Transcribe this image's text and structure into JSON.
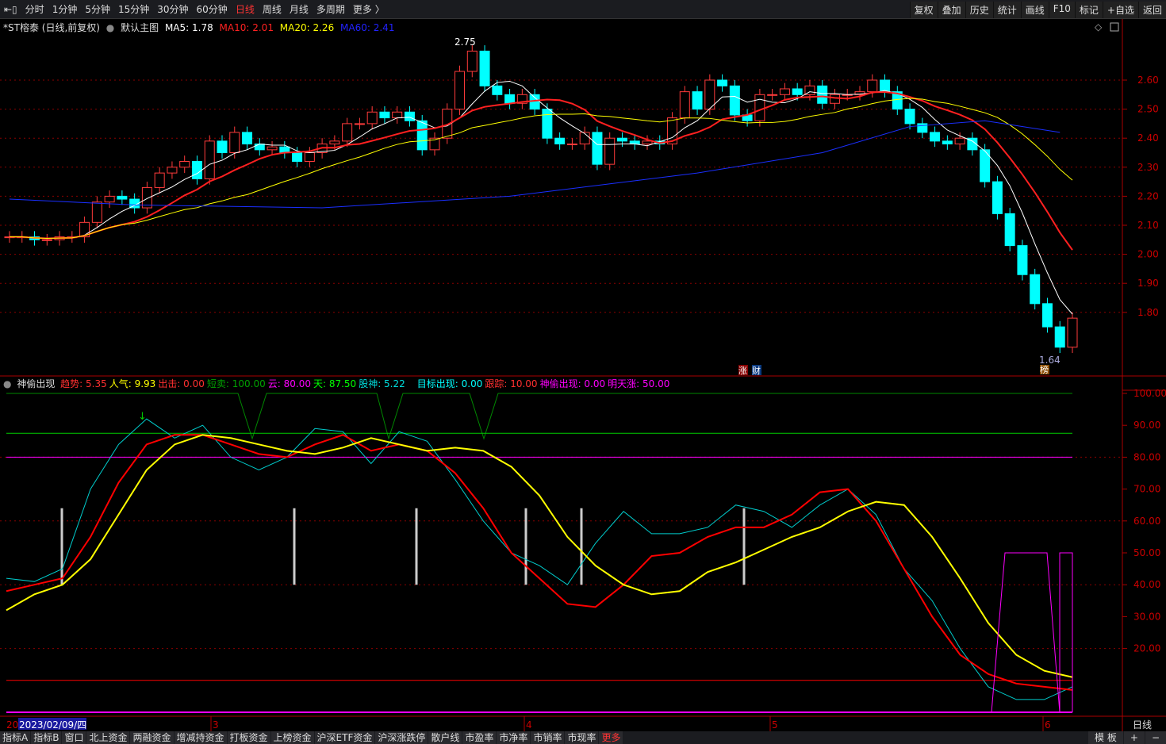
{
  "toolbar": {
    "tabs": [
      "分时",
      "1分钟",
      "5分钟",
      "15分钟",
      "30分钟",
      "60分钟",
      "日线",
      "周线",
      "月线",
      "多周期",
      "更多 〉"
    ],
    "active": "日线",
    "right": [
      "复权",
      "叠加",
      "历史",
      "统计",
      "画线",
      "F10",
      "标记",
      "+自选",
      "返回"
    ]
  },
  "info": {
    "title": "*ST榕泰 (日线,前复权)",
    "main": "默认主图",
    "ma5": "MA5: 1.78",
    "ma10": "MA10: 2.01",
    "ma20": "MA20: 2.26",
    "ma60": "MA60: 2.41"
  },
  "colors": {
    "up": "#ff3b3b",
    "down": "#00ffff",
    "ma5": "#ffffff",
    "ma10": "#ff2020",
    "ma20": "#ffff00",
    "ma60": "#1a2fff",
    "grid": "#8b0000"
  },
  "price_axis": [
    "2.60",
    "2.50",
    "2.40",
    "2.30",
    "2.20",
    "2.10",
    "2.00",
    "1.90",
    "1.80"
  ],
  "annotations": {
    "high": "2.75",
    "low": "1.64",
    "badge_bang": "榜",
    "badge_zhang": "涨",
    "badge_cai": "财"
  },
  "chart_data": {
    "type": "candlestick",
    "closes": [
      2.06,
      2.06,
      2.05,
      2.05,
      2.06,
      2.06,
      2.11,
      2.18,
      2.2,
      2.19,
      2.16,
      2.23,
      2.28,
      2.3,
      2.32,
      2.26,
      2.39,
      2.35,
      2.42,
      2.38,
      2.36,
      2.37,
      2.35,
      2.32,
      2.35,
      2.38,
      2.39,
      2.45,
      2.45,
      2.49,
      2.47,
      2.49,
      2.46,
      2.36,
      2.4,
      2.5,
      2.63,
      2.7,
      2.58,
      2.55,
      2.52,
      2.55,
      2.5,
      2.4,
      2.38,
      2.38,
      2.42,
      2.31,
      2.4,
      2.39,
      2.38,
      2.39,
      2.38,
      2.47,
      2.56,
      2.5,
      2.6,
      2.58,
      2.48,
      2.46,
      2.55,
      2.55,
      2.57,
      2.55,
      2.58,
      2.52,
      2.55,
      2.55,
      2.56,
      2.6,
      2.56,
      2.5,
      2.45,
      2.42,
      2.39,
      2.38,
      2.4,
      2.36,
      2.25,
      2.14,
      2.03,
      1.93,
      1.83,
      1.75,
      1.68,
      1.78
    ],
    "ma60": [
      [
        0,
        2.19
      ],
      [
        10,
        2.17
      ],
      [
        25,
        2.16
      ],
      [
        40,
        2.2
      ],
      [
        55,
        2.28
      ],
      [
        65,
        2.35
      ],
      [
        72,
        2.44
      ],
      [
        78,
        2.46
      ],
      [
        84,
        2.42
      ]
    ],
    "price_range": [
      1.62,
      2.82
    ]
  },
  "indicator": {
    "name": "神偷出现",
    "items": [
      [
        "趋势: 5.35",
        "#ff3030"
      ],
      [
        "人气: 9.93",
        "#ffff00"
      ],
      [
        "出击: 0.00",
        "#ff3030"
      ],
      [
        "短卖: 100.00",
        "#00a000"
      ],
      [
        "云: 80.00",
        "#ff00ff"
      ],
      [
        "天: 87.50",
        "#00ff00"
      ],
      [
        "股神: 5.22",
        "#00dddd"
      ],
      [
        "目标出现: 0.00",
        "#00ffff"
      ],
      [
        "跟踪: 10.00",
        "#ff3030"
      ],
      [
        "神偷出现: 0.00",
        "#ff00ff"
      ],
      [
        "明天涨: 50.00",
        "#ff00ff"
      ]
    ],
    "axis": [
      "100.00",
      "90.00",
      "80.00",
      "70.00",
      "60.00",
      "50.00",
      "40.00",
      "30.00",
      "20.00"
    ],
    "yellow": [
      32,
      37,
      40,
      48,
      62,
      76,
      84,
      87,
      86,
      84,
      82,
      81,
      83,
      86,
      84,
      82,
      83,
      82,
      77,
      68,
      55,
      46,
      40,
      37,
      38,
      44,
      47,
      51,
      55,
      58,
      63,
      66,
      65,
      55,
      42,
      28,
      18,
      13,
      11
    ],
    "red": [
      38,
      40,
      42,
      55,
      72,
      84,
      87,
      87,
      84,
      81,
      80,
      84,
      87,
      82,
      84,
      82,
      75,
      64,
      50,
      42,
      34,
      33,
      40,
      49,
      50,
      55,
      58,
      58,
      62,
      69,
      70,
      60,
      45,
      30,
      18,
      12,
      9,
      8,
      7
    ],
    "cyan": [
      42,
      41,
      45,
      70,
      84,
      92,
      86,
      90,
      80,
      76,
      80,
      89,
      88,
      78,
      88,
      85,
      73,
      60,
      50,
      46,
      40,
      53,
      63,
      56,
      56,
      58,
      65,
      63,
      58,
      65,
      70,
      62,
      45,
      35,
      20,
      8,
      4,
      4,
      8
    ],
    "bars": [
      4,
      21,
      30,
      36,
      40,
      52
    ],
    "magenta": [
      [
        0,
        0
      ],
      [
        73,
        0
      ],
      [
        74,
        50
      ],
      [
        78,
        50
      ],
      [
        79,
        0
      ],
      [
        80,
        50
      ],
      [
        81,
        0
      ],
      [
        82,
        50
      ]
    ]
  },
  "xaxis": [
    "20",
    "2023/02/09/四",
    "3",
    "4",
    "5",
    "6"
  ],
  "period_label": "日线",
  "bottom": [
    "指标A",
    "指标B",
    "窗口",
    "北上资金",
    "两融资金",
    "增减持资金",
    "打板资金",
    "上榜资金",
    "沪深ETF资金",
    "沪深涨跌停",
    "散户线",
    "市盈率",
    "市净率",
    "市销率",
    "市现率",
    "更多"
  ],
  "bottom_right": [
    "模 板",
    "+",
    "−"
  ]
}
